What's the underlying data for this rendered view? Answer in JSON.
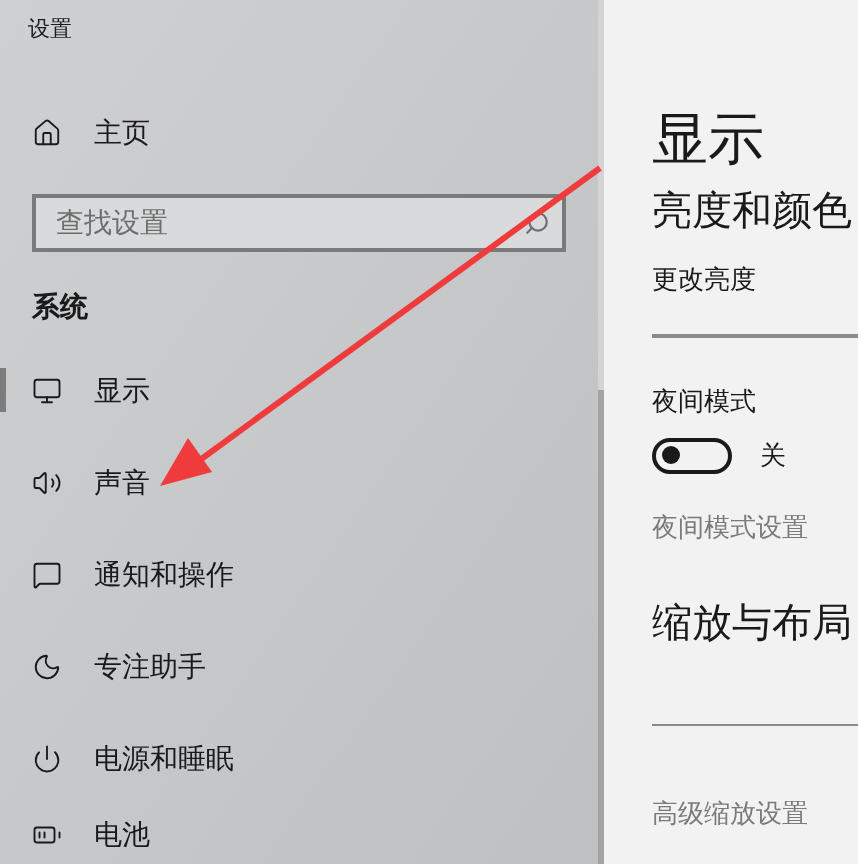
{
  "window": {
    "title": "设置"
  },
  "sidebar": {
    "home": "主页",
    "search": {
      "placeholder": "查找设置"
    },
    "section": "系统",
    "items": [
      {
        "label": "显示",
        "selected": true
      },
      {
        "label": "声音",
        "selected": false
      },
      {
        "label": "通知和操作",
        "selected": false
      },
      {
        "label": "专注助手",
        "selected": false
      },
      {
        "label": "电源和睡眠",
        "selected": false
      },
      {
        "label": "电池",
        "selected": false
      }
    ]
  },
  "content": {
    "title": "显示",
    "brightness_heading": "亮度和颜色",
    "brightness_label": "更改亮度",
    "night_mode": {
      "label": "夜间模式",
      "on": false,
      "state_text": "关"
    },
    "night_mode_settings": "夜间模式设置",
    "scale_heading": "缩放与布局",
    "advanced_scaling": "高级缩放设置"
  }
}
